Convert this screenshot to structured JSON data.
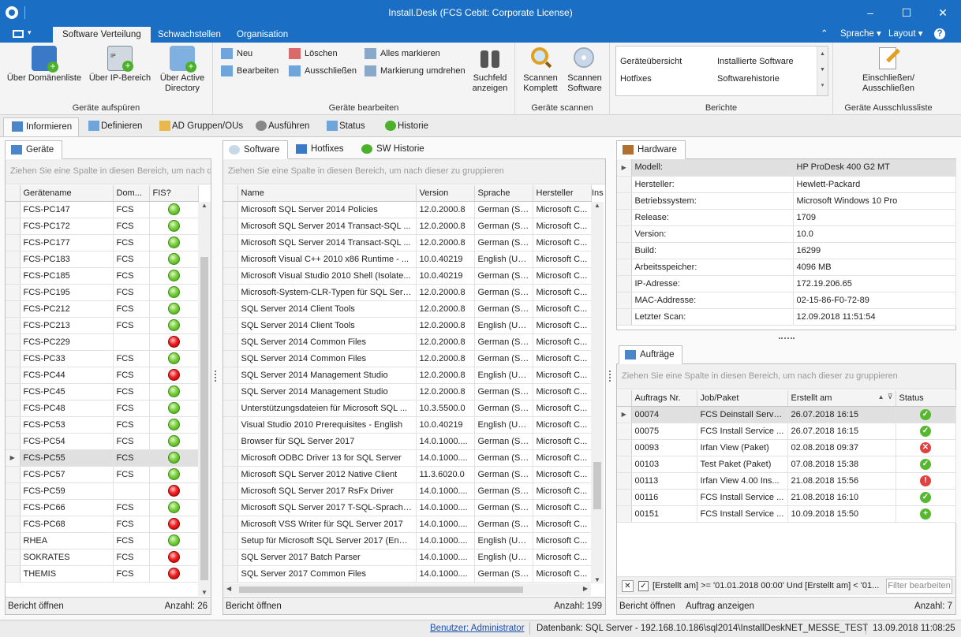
{
  "window": {
    "title": "Install.Desk (FCS Cebit: Corporate License)",
    "minimize": "–",
    "maximize": "☐",
    "close": "✕"
  },
  "ribbon_tabs": {
    "software_verteilung": "Software Verteilung",
    "schwachstellen": "Schwachstellen",
    "organisation": "Organisation"
  },
  "ribbon_right": {
    "sprache": "Sprache ▾",
    "layout": "Layout ▾",
    "help": "? ▾",
    "collapse": "⌃"
  },
  "ribbon": {
    "g1": {
      "label": "Geräte aufspüren",
      "b1": "Über Domänenliste",
      "b2": "Über IP-Bereich",
      "b3a": "Über Active",
      "b3b": "Directory"
    },
    "g2": {
      "label": "Geräte bearbeiten",
      "neu": "Neu",
      "bearbeiten": "Bearbeiten",
      "loeschen": "Löschen",
      "ausschliessen": "Ausschließen",
      "alle": "Alles markieren",
      "umdrehen": "Markierung umdrehen",
      "suchfeld_a": "Suchfeld",
      "suchfeld_b": "anzeigen"
    },
    "g3": {
      "label": "Geräte scannen",
      "k_a": "Scannen",
      "k_b": "Komplett",
      "s_a": "Scannen",
      "s_b": "Software"
    },
    "g4": {
      "label": "Berichte",
      "r1": "Geräteübersicht",
      "r2": "Installierte Software",
      "r3": "Hotfixes",
      "r4": "Softwarehistorie"
    },
    "g5": {
      "label": "Geräte Ausschlussliste",
      "b_a": "Einschließen/",
      "b_b": "Ausschließen"
    }
  },
  "main_tabs": {
    "informieren": "Informieren",
    "definieren": "Definieren",
    "ad": "AD Gruppen/OUs",
    "ausfuehren": "Ausführen",
    "status": "Status",
    "historie": "Historie"
  },
  "geraete": {
    "tab": "Geräte",
    "group_hint": "Ziehen Sie eine Spalte in diesen Bereich, um nach die",
    "columns": {
      "name": "Gerätename",
      "dom": "Dom...",
      "fis": "FIS?"
    },
    "rows": [
      {
        "name": "FCS-PC147",
        "dom": "FCS",
        "fis": "green"
      },
      {
        "name": "FCS-PC172",
        "dom": "FCS",
        "fis": "green"
      },
      {
        "name": "FCS-PC177",
        "dom": "FCS",
        "fis": "green"
      },
      {
        "name": "FCS-PC183",
        "dom": "FCS",
        "fis": "green"
      },
      {
        "name": "FCS-PC185",
        "dom": "FCS",
        "fis": "green"
      },
      {
        "name": "FCS-PC195",
        "dom": "FCS",
        "fis": "green"
      },
      {
        "name": "FCS-PC212",
        "dom": "FCS",
        "fis": "green"
      },
      {
        "name": "FCS-PC213",
        "dom": "FCS",
        "fis": "green"
      },
      {
        "name": "FCS-PC229",
        "dom": "",
        "fis": "red"
      },
      {
        "name": "FCS-PC33",
        "dom": "FCS",
        "fis": "green"
      },
      {
        "name": "FCS-PC44",
        "dom": "FCS",
        "fis": "red"
      },
      {
        "name": "FCS-PC45",
        "dom": "FCS",
        "fis": "green"
      },
      {
        "name": "FCS-PC48",
        "dom": "FCS",
        "fis": "green"
      },
      {
        "name": "FCS-PC53",
        "dom": "FCS",
        "fis": "green"
      },
      {
        "name": "FCS-PC54",
        "dom": "FCS",
        "fis": "green"
      },
      {
        "name": "FCS-PC55",
        "dom": "FCS",
        "fis": "green",
        "selected": true
      },
      {
        "name": "FCS-PC57",
        "dom": "FCS",
        "fis": "green"
      },
      {
        "name": "FCS-PC59",
        "dom": "",
        "fis": "red"
      },
      {
        "name": "FCS-PC66",
        "dom": "FCS",
        "fis": "green"
      },
      {
        "name": "FCS-PC68",
        "dom": "FCS",
        "fis": "red"
      },
      {
        "name": "RHEA",
        "dom": "FCS",
        "fis": "green"
      },
      {
        "name": "SOKRATES",
        "dom": "FCS",
        "fis": "red"
      },
      {
        "name": "THEMIS",
        "dom": "FCS",
        "fis": "red"
      }
    ],
    "footer_left": "Bericht öffnen",
    "footer_right": "Anzahl: 26"
  },
  "software": {
    "tabs": {
      "software": "Software",
      "hotfixes": "Hotfixes",
      "sw_historie": "SW Historie"
    },
    "group_hint": "Ziehen Sie eine Spalte in diesen Bereich, um nach dieser zu gruppieren",
    "columns": {
      "name": "Name",
      "version": "Version",
      "sprache": "Sprache",
      "hersteller": "Hersteller",
      "ins": "Ins"
    },
    "rows": [
      {
        "name": "Microsoft SQL Server 2014 Policies",
        "version": "12.0.2000.8",
        "sprache": "German (St...",
        "hersteller": "Microsoft C..."
      },
      {
        "name": "Microsoft SQL Server 2014 Transact-SQL ...",
        "version": "12.0.2000.8",
        "sprache": "German (St...",
        "hersteller": "Microsoft C..."
      },
      {
        "name": "Microsoft SQL Server 2014 Transact-SQL ...",
        "version": "12.0.2000.8",
        "sprache": "German (St...",
        "hersteller": "Microsoft C..."
      },
      {
        "name": "Microsoft Visual C++ 2010  x86 Runtime - ...",
        "version": "10.0.40219",
        "sprache": "English (Uni...",
        "hersteller": "Microsoft C..."
      },
      {
        "name": "Microsoft Visual Studio 2010 Shell (Isolate...",
        "version": "10.0.40219",
        "sprache": "German (St...",
        "hersteller": "Microsoft C..."
      },
      {
        "name": "Microsoft-System-CLR-Typen für SQL Serv...",
        "version": "12.0.2000.8",
        "sprache": "German (St...",
        "hersteller": "Microsoft C..."
      },
      {
        "name": "SQL Server 2014 Client Tools",
        "version": "12.0.2000.8",
        "sprache": "German (St...",
        "hersteller": "Microsoft C..."
      },
      {
        "name": "SQL Server 2014 Client Tools",
        "version": "12.0.2000.8",
        "sprache": "English (Uni...",
        "hersteller": "Microsoft C..."
      },
      {
        "name": "SQL Server 2014 Common Files",
        "version": "12.0.2000.8",
        "sprache": "German (St...",
        "hersteller": "Microsoft C..."
      },
      {
        "name": "SQL Server 2014 Common Files",
        "version": "12.0.2000.8",
        "sprache": "German (St...",
        "hersteller": "Microsoft C..."
      },
      {
        "name": "SQL Server 2014 Management Studio",
        "version": "12.0.2000.8",
        "sprache": "English (Uni...",
        "hersteller": "Microsoft C..."
      },
      {
        "name": "SQL Server 2014 Management Studio",
        "version": "12.0.2000.8",
        "sprache": "German (St...",
        "hersteller": "Microsoft C..."
      },
      {
        "name": "Unterstützungsdateien für Microsoft SQL ...",
        "version": "10.3.5500.0",
        "sprache": "German (St...",
        "hersteller": "Microsoft C..."
      },
      {
        "name": "Visual Studio 2010 Prerequisites - English",
        "version": "10.0.40219",
        "sprache": "English (Uni...",
        "hersteller": "Microsoft C..."
      },
      {
        "name": "Browser für SQL Server 2017",
        "version": "14.0.1000....",
        "sprache": "German (St...",
        "hersteller": "Microsoft C..."
      },
      {
        "name": "Microsoft ODBC Driver 13 for SQL Server",
        "version": "14.0.1000....",
        "sprache": "German (St...",
        "hersteller": "Microsoft C..."
      },
      {
        "name": "Microsoft SQL Server 2012 Native Client",
        "version": "11.3.6020.0",
        "sprache": "German (St...",
        "hersteller": "Microsoft C..."
      },
      {
        "name": "Microsoft SQL Server 2017 RsFx Driver",
        "version": "14.0.1000....",
        "sprache": "German (St...",
        "hersteller": "Microsoft C..."
      },
      {
        "name": "Microsoft SQL Server 2017 T-SQL-Sprachd...",
        "version": "14.0.1000....",
        "sprache": "German (St...",
        "hersteller": "Microsoft C..."
      },
      {
        "name": "Microsoft VSS Writer für SQL Server 2017",
        "version": "14.0.1000....",
        "sprache": "German (St...",
        "hersteller": "Microsoft C..."
      },
      {
        "name": "Setup für Microsoft SQL Server 2017 (Engl...",
        "version": "14.0.1000....",
        "sprache": "English (Uni...",
        "hersteller": "Microsoft C..."
      },
      {
        "name": "SQL Server 2017 Batch Parser",
        "version": "14.0.1000....",
        "sprache": "English (Uni...",
        "hersteller": "Microsoft C..."
      },
      {
        "name": "SQL Server 2017 Common Files",
        "version": "14.0.1000....",
        "sprache": "German (St...",
        "hersteller": "Microsoft C..."
      }
    ],
    "footer_left": "Bericht öffnen",
    "footer_right": "Anzahl: 199"
  },
  "hardware": {
    "tab": "Hardware",
    "rows": [
      {
        "key": "Modell:",
        "value": "HP ProDesk 400 G2 MT",
        "selected": true
      },
      {
        "key": "Hersteller:",
        "value": "Hewlett-Packard"
      },
      {
        "key": "Betriebssystem:",
        "value": "Microsoft Windows 10 Pro"
      },
      {
        "key": "Release:",
        "value": "1709"
      },
      {
        "key": "Version:",
        "value": "10.0"
      },
      {
        "key": "Build:",
        "value": "16299"
      },
      {
        "key": "Arbeitsspeicher:",
        "value": "4096 MB"
      },
      {
        "key": "IP-Adresse:",
        "value": "172.19.206.65"
      },
      {
        "key": "MAC-Addresse:",
        "value": "02-15-86-F0-72-89"
      },
      {
        "key": "Letzter Scan:",
        "value": "12.09.2018 11:51:54"
      }
    ]
  },
  "auftraege": {
    "tab": "Aufträge",
    "group_hint": "Ziehen Sie eine Spalte in diesen Bereich, um nach dieser zu gruppieren",
    "columns": {
      "nr": "Auftrags Nr.",
      "job": "Job/Paket",
      "erstellt": "Erstellt am",
      "status": "Status"
    },
    "rows": [
      {
        "nr": "00074",
        "job": "FCS Deinstall Servic...",
        "erstellt": "26.07.2018 16:15",
        "status": "ok",
        "selected": true
      },
      {
        "nr": "00075",
        "job": "FCS Install Service ...",
        "erstellt": "26.07.2018 16:15",
        "status": "ok"
      },
      {
        "nr": "00093",
        "job": "Irfan View (Paket)",
        "erstellt": "02.08.2018 09:37",
        "status": "err"
      },
      {
        "nr": "00103",
        "job": "Test Paket (Paket)",
        "erstellt": "07.08.2018 15:38",
        "status": "ok"
      },
      {
        "nr": "00113",
        "job": "Irfan View 4.00 Ins...",
        "erstellt": "21.08.2018 15:56",
        "status": "warn"
      },
      {
        "nr": "00116",
        "job": "FCS Install Service ...",
        "erstellt": "21.08.2018 16:10",
        "status": "ok"
      },
      {
        "nr": "00151",
        "job": "FCS Install Service ...",
        "erstellt": "10.09.2018 15:50",
        "status": "add"
      }
    ],
    "filter_text": "[Erstellt am] >= '01.01.2018 00:00' Und [Erstellt am] < '01...",
    "filter_edit": "Filter bearbeiten",
    "footer_left1": "Bericht öffnen",
    "footer_left2": "Auftrag anzeigen",
    "footer_right": "Anzahl: 7"
  },
  "statusbar": {
    "user": "Benutzer: Administrator",
    "db": "Datenbank: SQL Server - 192.168.10.186\\sql2014\\InstallDeskNET_MESSE_TEST",
    "time": "13.09.2018 11:08:25"
  },
  "colors": {
    "titlebar": "#1a6fc4",
    "ok": "#55b82e",
    "error": "#e04040"
  }
}
